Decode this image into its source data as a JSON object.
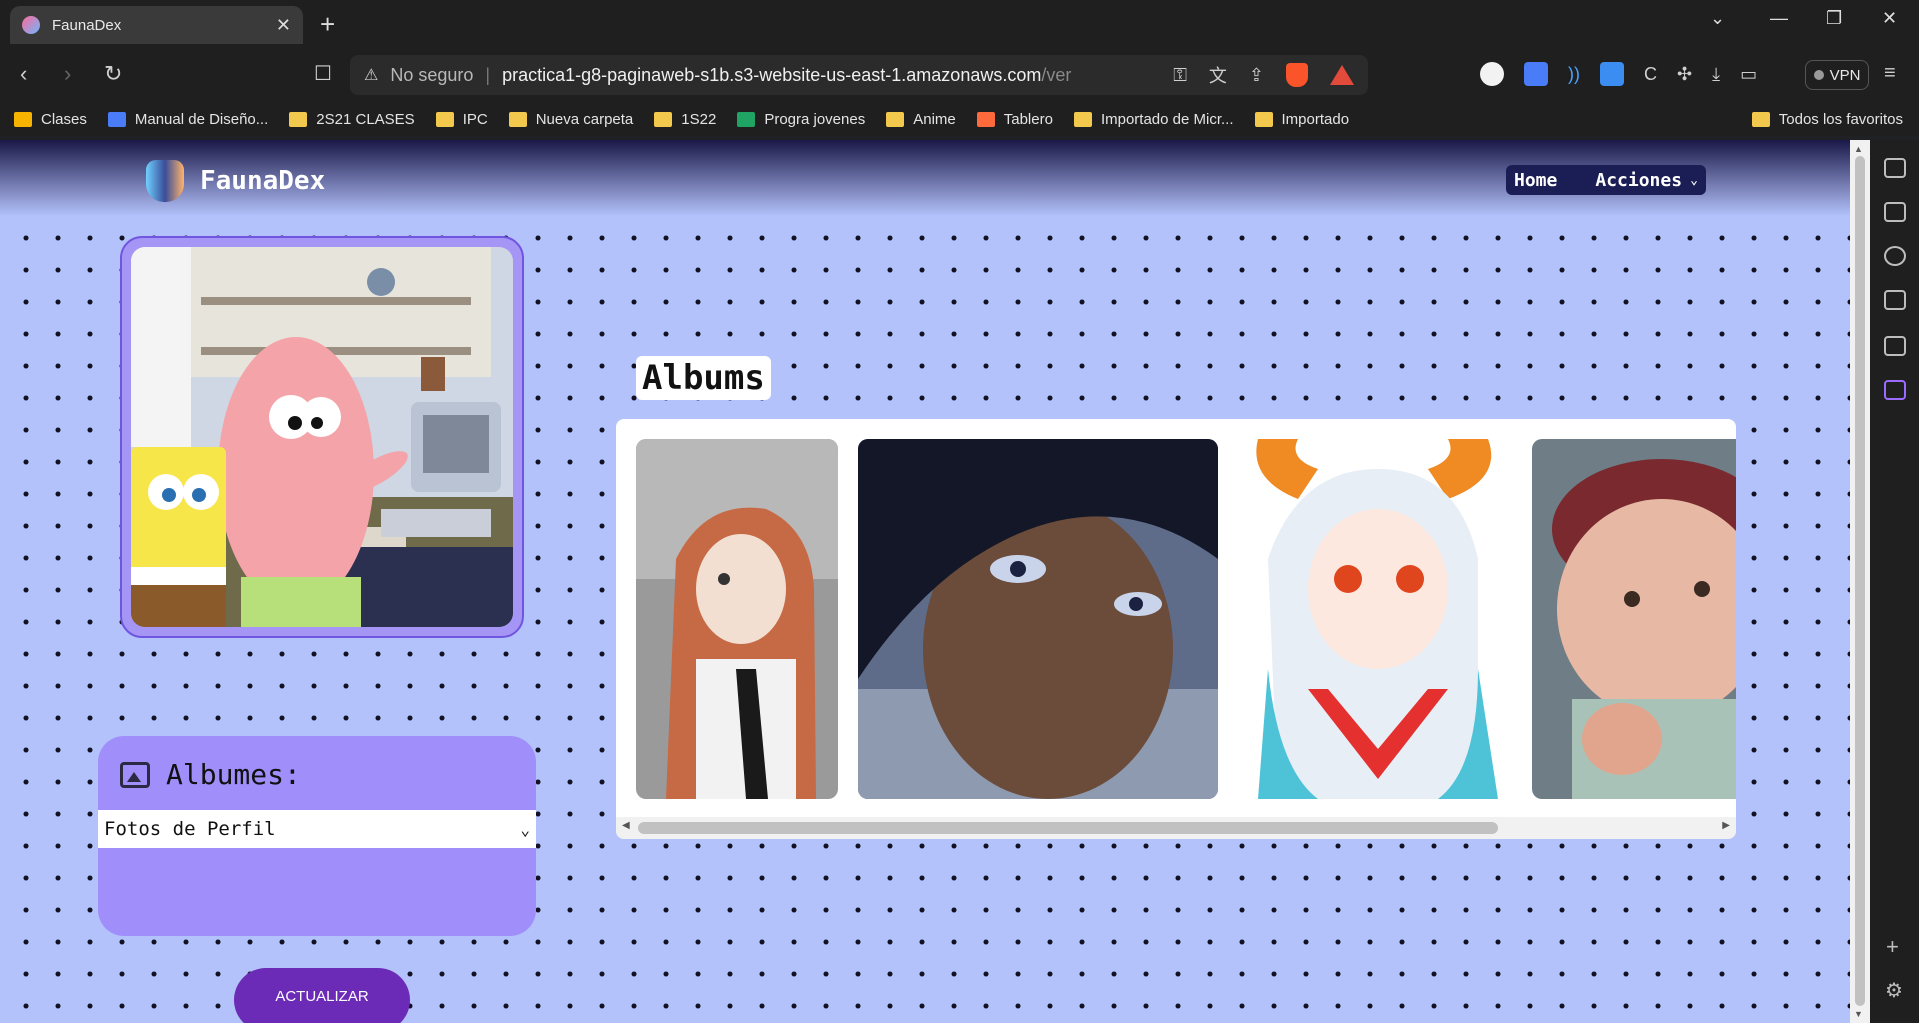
{
  "browser": {
    "tab_title": "FaunaDex",
    "tab_close": "✕",
    "new_tab": "+",
    "security_label": "No seguro",
    "url_host": "practica1-g8-paginaweb-s1b.s3-website-us-east-1.amazonaws.com",
    "url_path": "/ver",
    "vpn_label": "VPN"
  },
  "bookmarks": [
    {
      "label": "Clases",
      "icon": "classroom-icon",
      "color": "#f6b400"
    },
    {
      "label": "Manual de Diseño...",
      "icon": "docs-icon",
      "color": "#4a7cf7"
    },
    {
      "label": "2S21 CLASES",
      "icon": "folder-icon"
    },
    {
      "label": "IPC",
      "icon": "folder-icon"
    },
    {
      "label": "Nueva carpeta",
      "icon": "folder-icon"
    },
    {
      "label": "1S22",
      "icon": "folder-icon"
    },
    {
      "label": "Progra jovenes",
      "icon": "sheets-icon",
      "color": "#1fa463"
    },
    {
      "label": "Anime",
      "icon": "folder-icon"
    },
    {
      "label": "Tablero",
      "icon": "monday-icon",
      "color": "#ff6a3d"
    },
    {
      "label": "Importado de Micr...",
      "icon": "folder-icon"
    },
    {
      "label": "Importado",
      "icon": "folder-icon"
    }
  ],
  "bookmarks_right": "Todos los favoritos",
  "page": {
    "brand": "FaunaDex",
    "nav_home": "Home",
    "nav_actions": "Acciones",
    "albums_heading": "Albums",
    "albums_label": "Albumes:",
    "album_selected": "Fotos de Perfil",
    "update_button": "ACTUALIZAR"
  },
  "album_images": [
    {
      "name": "orange-haired-anime-woman-photo"
    },
    {
      "name": "dark-haired-anime-man-photo"
    },
    {
      "name": "horned-anime-girl-photo"
    },
    {
      "name": "baby-thumbs-up-photo"
    }
  ],
  "colors": {
    "page_bg": "#b3c2fb",
    "albums_card": "#a08ffb",
    "update_button": "#6c2bb7",
    "nav_pill": "#1b1d55"
  }
}
